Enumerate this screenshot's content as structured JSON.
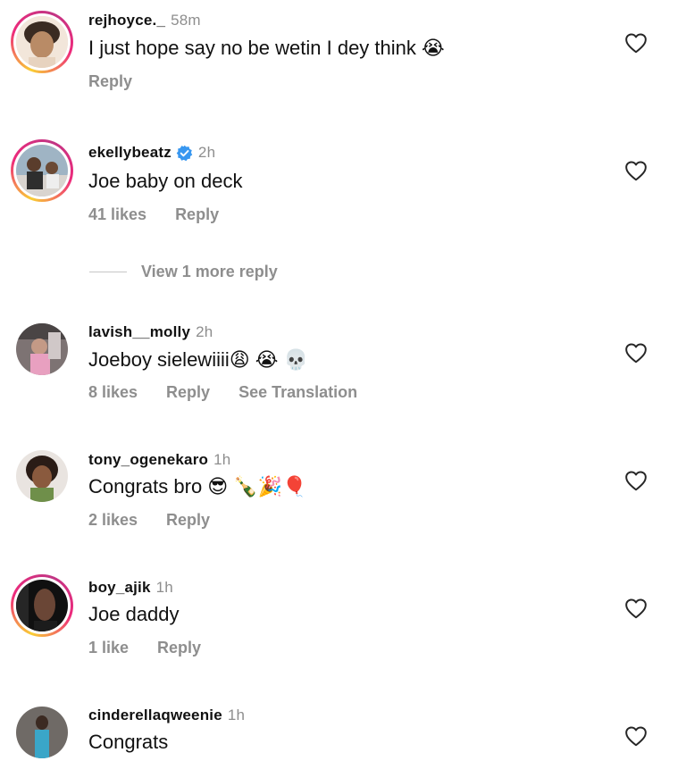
{
  "comments": [
    {
      "username": "rejhoyce._",
      "time": "58m",
      "text": "I just hope say no be wetin I dey think 😭",
      "likes": "",
      "reply": "Reply",
      "translation": "",
      "verified": false,
      "story_ring": true
    },
    {
      "username": "ekellybeatz",
      "time": "2h",
      "text": "Joe baby on deck",
      "likes": "41 likes",
      "reply": "Reply",
      "translation": "",
      "verified": true,
      "story_ring": true
    },
    {
      "username": "lavish__molly",
      "time": "2h",
      "text": "Joeboy sielewiiii😩 😭 💀",
      "likes": "8 likes",
      "reply": "Reply",
      "translation": "See Translation",
      "verified": false,
      "story_ring": false
    },
    {
      "username": "tony_ogenekaro",
      "time": "1h",
      "text": "Congrats bro 😎 🍾🎉🎈",
      "likes": "2 likes",
      "reply": "Reply",
      "translation": "",
      "verified": false,
      "story_ring": false
    },
    {
      "username": "boy_ajik",
      "time": "1h",
      "text": "Joe daddy",
      "likes": "1 like",
      "reply": "Reply",
      "translation": "",
      "verified": false,
      "story_ring": true
    },
    {
      "username": "cinderellaqweenie",
      "time": "1h",
      "text": "Congrats",
      "likes": "",
      "reply": "",
      "translation": "",
      "verified": false,
      "story_ring": false
    }
  ],
  "view_more_replies": "View 1 more reply",
  "icons": {
    "like": "heart-outline-icon",
    "verified": "verified-badge-icon"
  },
  "colors": {
    "text": "#111111",
    "muted": "#8e8e8e",
    "verified": "#3897f0",
    "story_ring_start": "#f9ce34",
    "story_ring_end": "#ee2a7b"
  }
}
